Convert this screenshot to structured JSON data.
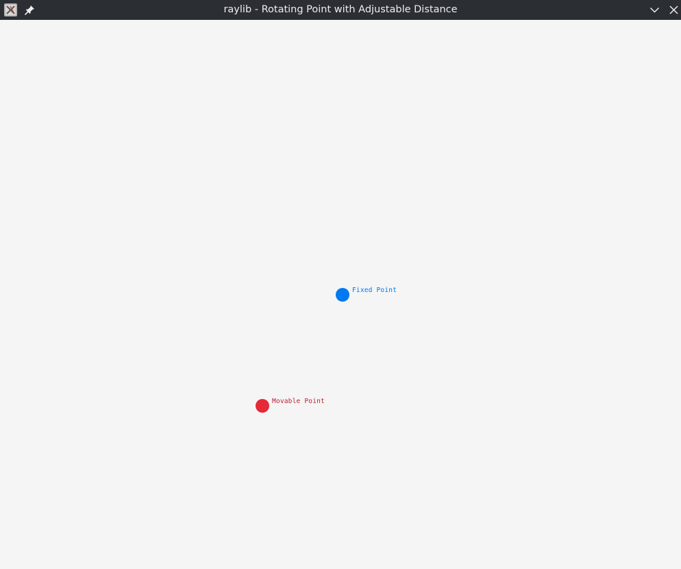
{
  "window": {
    "title": "raylib - Rotating Point with Adjustable Distance",
    "app_icon": "raylib-x11-icon",
    "pin_icon": "pin-icon",
    "minimize_icon": "chevron-down-icon",
    "close_icon": "close-icon"
  },
  "scene": {
    "background": "#f5f5f5",
    "fixed_point": {
      "label": "Fixed Point",
      "color": "#0079f1",
      "label_color": "#0079f1"
    },
    "movable_point": {
      "label": "Movable Point",
      "color": "#e62937",
      "label_color": "#be2130"
    }
  }
}
